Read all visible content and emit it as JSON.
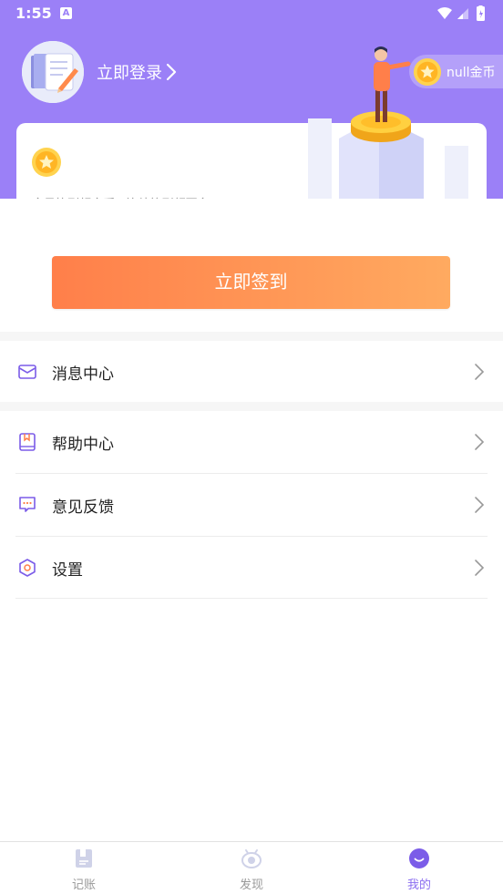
{
  "status_bar": {
    "time": "1:55",
    "notification_icon": "A"
  },
  "profile": {
    "login_label": "立即登录",
    "coins_label": "null金币"
  },
  "checkin_card": {
    "subtitle": "今日签到领金币 | 连续签到领更多",
    "button_label": "立即签到"
  },
  "menu": {
    "items": [
      {
        "label": "消息中心",
        "icon": "envelope-icon"
      },
      {
        "label": "帮助中心",
        "icon": "book-icon"
      },
      {
        "label": "意见反馈",
        "icon": "chat-bubble-icon"
      },
      {
        "label": "设置",
        "icon": "hexagon-settings-icon"
      }
    ]
  },
  "tabbar": {
    "tabs": [
      {
        "label": "记账",
        "icon": "ledger-icon",
        "active": false
      },
      {
        "label": "发现",
        "icon": "eye-icon",
        "active": false
      },
      {
        "label": "我的",
        "icon": "smile-icon",
        "active": true
      }
    ]
  },
  "colors": {
    "header": "#9b80f7",
    "accent": "#8b6ef0",
    "button_start": "#ff7f4a",
    "button_end": "#ffaa60"
  }
}
